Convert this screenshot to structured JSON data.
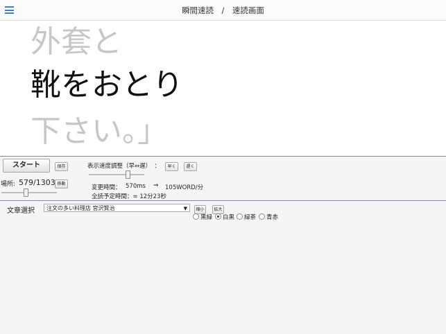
{
  "header": {
    "title": "瞬間速読　/　速読画面"
  },
  "reader": {
    "prev_line": "外套と",
    "current_line": "靴をおとり",
    "next_line": "下さい。」"
  },
  "controls": {
    "start_label": "スタート",
    "save_label": "保存",
    "speed_label": "表示速度調整（早⇔遅）　：",
    "fast_label": "早く",
    "slow_label": "遅く",
    "position_label": "場所:",
    "position_value": "579/1303",
    "move_label": "移動",
    "change_time_label": "変更時間：",
    "change_time_value": "570ms",
    "arrow": "⇒",
    "wpm": "105WORD/分",
    "total_time": "全読予定時間：= 12分23秒",
    "speed_level": 0.7,
    "position_level": 0.44
  },
  "text_select": {
    "label": "文章選択",
    "selected": "注文の多い料理店 宮沢賢治",
    "shrink_label": "縮小",
    "enlarge_label": "拡大"
  },
  "color_options": [
    {
      "label": "黒緑",
      "checked": false
    },
    {
      "label": "白黒",
      "checked": true
    },
    {
      "label": "緑茶",
      "checked": false
    },
    {
      "label": "青赤",
      "checked": false
    }
  ]
}
